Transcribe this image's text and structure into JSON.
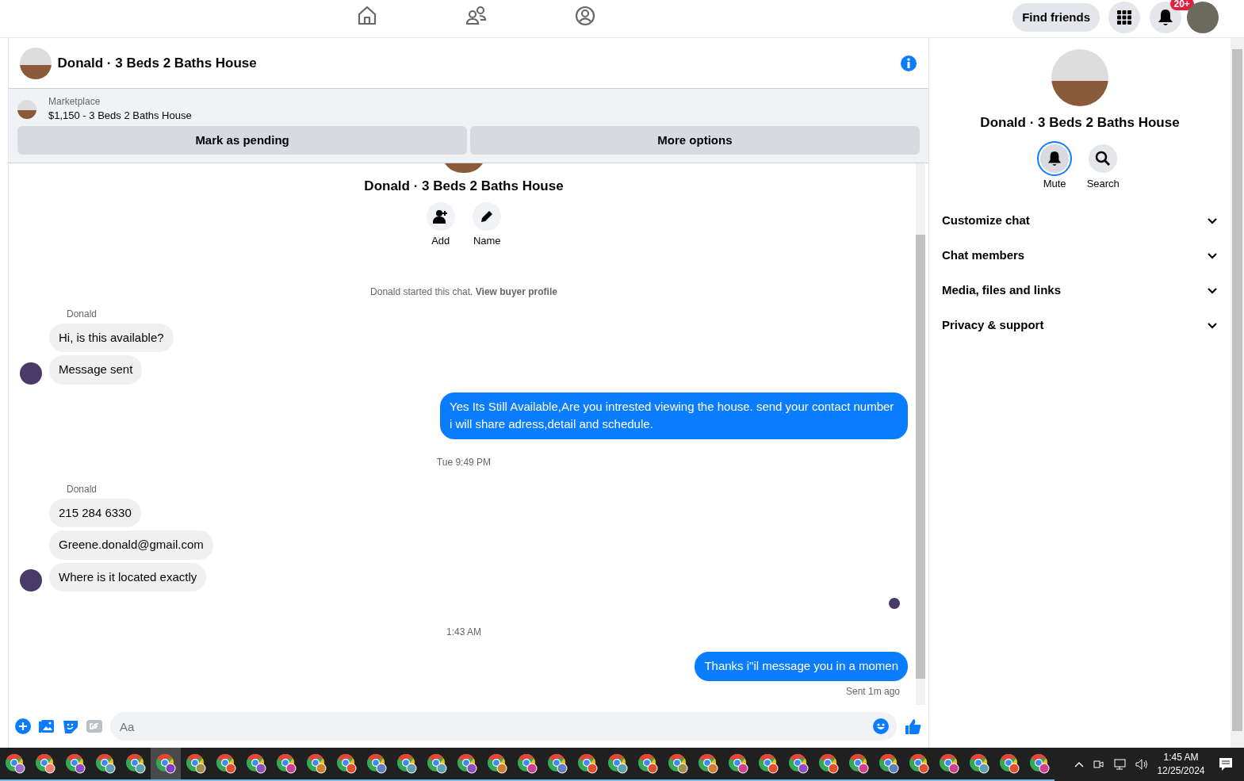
{
  "top_nav": {
    "find_friends": "Find friends",
    "notification_count": "20+"
  },
  "chat_header": {
    "title": "Donald · 3 Beds 2 Baths House"
  },
  "listing": {
    "source": "Marketplace",
    "summary": "$1,150 - 3 Beds 2 Baths House",
    "buttons": [
      "Mark as pending",
      "More options"
    ]
  },
  "conversation": {
    "title": "Donald · 3 Beds 2 Baths House",
    "actions": [
      "Add",
      "Name"
    ],
    "intro": "Donald started this chat. **View buyer profile**"
  },
  "messages": [
    {
      "kind": "sender",
      "text": "Donald"
    },
    {
      "kind": "incoming",
      "text": "Hi, is this available?",
      "avatar": false
    },
    {
      "kind": "incoming",
      "text": "Message sent",
      "avatar": true
    },
    {
      "kind": "outgoing",
      "text": "Yes Its Still Available,Are you intrested viewing the house. send your contact number i will share adress,detail and schedule."
    },
    {
      "kind": "time",
      "text": "Tue 9:49 PM"
    },
    {
      "kind": "sender",
      "text": "Donald"
    },
    {
      "kind": "incoming",
      "text": "215 284 6330",
      "avatar": false
    },
    {
      "kind": "incoming",
      "text": "Greene.donald@gmail.com",
      "avatar": false
    },
    {
      "kind": "incoming",
      "text": "Where is it located exactly",
      "avatar": true
    },
    {
      "kind": "seen"
    },
    {
      "kind": "time",
      "text": "1:43 AM"
    },
    {
      "kind": "outgoing",
      "text": "Thanks i\"il message you in a momen"
    },
    {
      "kind": "status",
      "text": "Sent 1m ago"
    }
  ],
  "composer": {
    "placeholder": "Aa"
  },
  "side_panel": {
    "title": "Donald · 3 Beds 2 Baths House",
    "actions": [
      {
        "label": "Mute",
        "selected": true
      },
      {
        "label": "Search",
        "selected": false
      }
    ],
    "sections": [
      {
        "label": "Customize chat",
        "expanded": false
      },
      {
        "label": "Chat members",
        "expanded": false
      },
      {
        "label": "Media, files and links",
        "expanded": false
      },
      {
        "label": "Privacy & support",
        "expanded": false
      }
    ]
  },
  "taskbar": {
    "apps": [
      {
        "color": "#a070d0",
        "selected": false
      },
      {
        "color": "#f08070",
        "selected": false
      },
      {
        "color": "#9050c0",
        "selected": false
      },
      {
        "color": "#60a0b0",
        "selected": false
      },
      {
        "color": "#60a0b0",
        "selected": false
      },
      {
        "color": "#8040c0",
        "selected": true
      },
      {
        "color": "#a09050",
        "selected": false
      },
      {
        "color": "#e05030",
        "selected": false
      },
      {
        "color": "#9050c0",
        "selected": false
      },
      {
        "color": "#d04090",
        "selected": false
      },
      {
        "color": "#d08030",
        "selected": false
      },
      {
        "color": "#e05030",
        "selected": false
      },
      {
        "color": "#6080c0",
        "selected": false
      },
      {
        "color": "#60a0b0",
        "selected": false
      },
      {
        "color": "#60a0b0",
        "selected": false
      },
      {
        "color": "#9050c0",
        "selected": false
      },
      {
        "color": "#d08030",
        "selected": false
      },
      {
        "color": "#d04090",
        "selected": false
      },
      {
        "color": "#6080c0",
        "selected": false
      },
      {
        "color": "#e05030",
        "selected": false
      },
      {
        "color": "#60a0b0",
        "selected": false
      },
      {
        "color": "#e05030",
        "selected": false
      },
      {
        "color": "#a09050",
        "selected": false
      },
      {
        "color": "#d08030",
        "selected": false
      },
      {
        "color": "#d04090",
        "selected": false
      },
      {
        "color": "#e05030",
        "selected": false
      },
      {
        "color": "#9050c0",
        "selected": false
      },
      {
        "color": "#e05030",
        "selected": false
      },
      {
        "color": "#d04090",
        "selected": false
      },
      {
        "color": "#6080c0",
        "selected": false
      },
      {
        "color": "#e05030",
        "selected": false
      },
      {
        "color": "#d04090",
        "selected": false
      },
      {
        "color": "#60a0b0",
        "selected": false
      },
      {
        "color": "#e05030",
        "selected": false
      },
      {
        "color": "#d04090",
        "selected": false
      }
    ],
    "time": "1:45 AM",
    "date": "12/25/2024"
  }
}
